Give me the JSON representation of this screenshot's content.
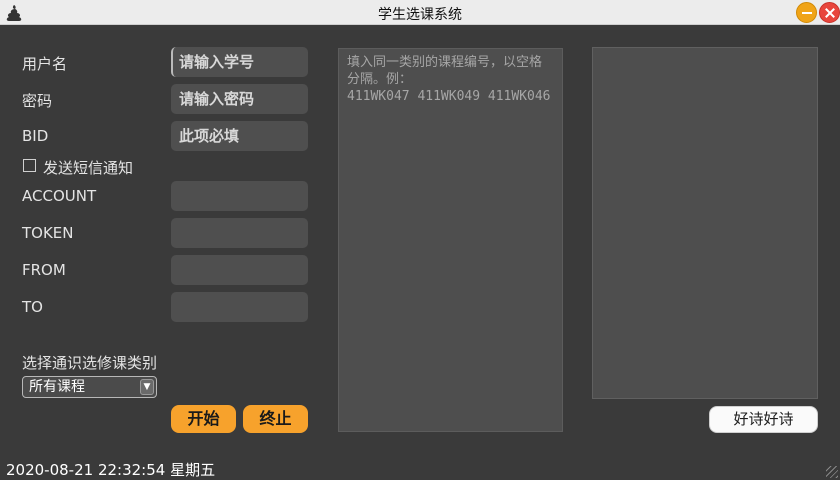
{
  "window": {
    "title": "学生选课系统",
    "app_icon": "poop-icon"
  },
  "form": {
    "username_label": "用户名",
    "username_placeholder": "请输入学号",
    "password_label": "密码",
    "password_placeholder": "请输入密码",
    "bid_label": "BID",
    "bid_placeholder": "此项必填",
    "sms_label": "发送短信通知",
    "sms_checked": false,
    "account_label": "ACCOUNT",
    "token_label": "TOKEN",
    "from_label": "FROM",
    "to_label": "TO",
    "category_label": "选择通识选修课类别",
    "category_selected": "所有课程"
  },
  "buttons": {
    "start": "开始",
    "stop": "终止",
    "poem": "好诗好诗"
  },
  "course_input": {
    "placeholder": "填入同一类别的课程编号，以空格分隔。例：\n411WK047 411WK049 411WK046"
  },
  "status": {
    "datetime": "2020-08-21 22:32:54 星期五"
  },
  "colors": {
    "background": "#3a3a3a",
    "accent": "#f7a22c",
    "field": "#4f4f4f"
  }
}
